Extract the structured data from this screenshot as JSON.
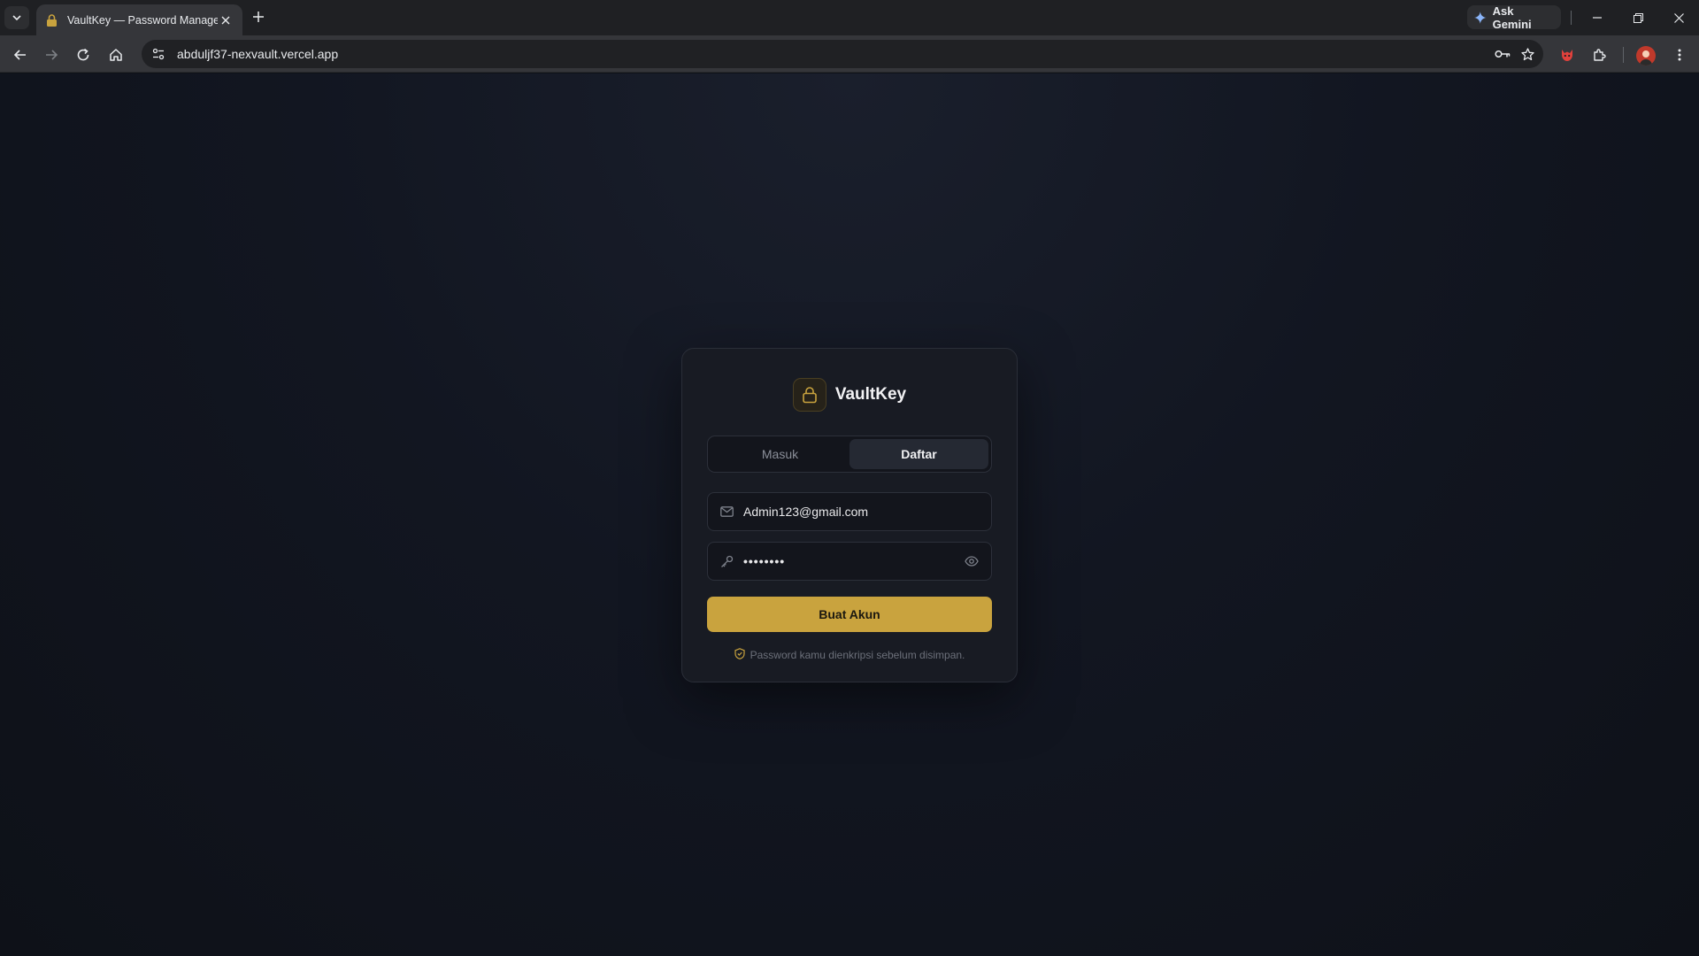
{
  "browser": {
    "tab_title": "VaultKey — Password Manager",
    "gemini_label": "Ask Gemini",
    "url": "abduljf37-nexvault.vercel.app"
  },
  "auth": {
    "brand_name": "VaultKey",
    "tabs": [
      {
        "label": "Masuk",
        "active": false
      },
      {
        "label": "Daftar",
        "active": true
      }
    ],
    "email_value": "Admin123@gmail.com",
    "password_value": "••••••••",
    "submit_label": "Buat Akun",
    "note": "Password kamu dienkripsi sebelum disimpan."
  },
  "colors": {
    "accent": "#c9a33e",
    "card_bg": "#181b23",
    "page_bg": "#0e1118"
  }
}
